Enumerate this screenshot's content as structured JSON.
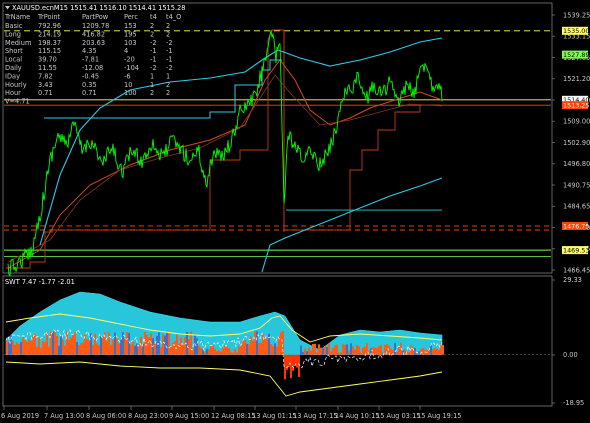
{
  "main_chart": {
    "header": "XAUUSD.ecnM15  1515.41  1516.10  1514.41  1515.28",
    "colors": {
      "background": "#000000",
      "price": "#00ff00",
      "upper_band": "#2fc9e6",
      "lower_band": "#2fc9e6",
      "ma_main": "#d04a1e",
      "ma_inner": "#8b3518",
      "frame": "#7f7f7f",
      "level_yellow": "#ffff66",
      "level_green": "#7cff4a",
      "level_orange": "#ff4500"
    },
    "price_axis": {
      "min": 1463.0,
      "max": 1543.0,
      "labels": [
        "1539.25",
        "1533.15",
        "1527.05",
        "1521.20",
        "1515.10",
        "1509.00",
        "1502.90",
        "1496.80",
        "1490.75",
        "1484.65",
        "1478.60",
        "1472.45",
        "1466.45"
      ]
    },
    "price_tags": [
      {
        "text": "1535.00",
        "value": 1535.0,
        "bg": "#ffff66",
        "fg": "#000000",
        "line": "dash"
      },
      {
        "text": "1527.89",
        "value": 1527.89,
        "bg": "#7cff4a",
        "fg": "#000000",
        "line": "none"
      },
      {
        "text": "1514.40",
        "value": 1514.4,
        "bg": "#ffffff",
        "fg": "#000000",
        "line": "solid-yellow"
      },
      {
        "text": "1513.25",
        "value": 1512.8,
        "bg": "#ff4500",
        "fg": "#ffffff",
        "line": "solid-orange"
      },
      {
        "text": "1476.75",
        "value": 1476.75,
        "bg": "#ff4500",
        "fg": "#ffffff",
        "line": "dash-orange"
      },
      {
        "text": "1469.53",
        "value": 1469.53,
        "bg": "#ffff66",
        "fg": "#000000",
        "line": "solid-green"
      }
    ],
    "stats_table": {
      "columns": [
        "TrName",
        "TrPoint",
        "PartPow",
        "Perc",
        "t4",
        "t4_O"
      ],
      "rows": [
        [
          "Basic",
          "792.96",
          "1209.78",
          "153",
          "2",
          "2"
        ],
        [
          "Long",
          "214.19",
          "416.82",
          "195",
          "2",
          "2"
        ],
        [
          "Medium",
          "198.37",
          "203.63",
          "103",
          "-2",
          "-2"
        ],
        [
          "Short",
          "115.15",
          "4.35",
          "4",
          "-1",
          "-1"
        ],
        [
          "Local",
          "39.70",
          "-7.81",
          "-20",
          "-1",
          "-1"
        ],
        [
          "Daily",
          "11.55",
          "-12.08",
          "-104",
          "-2",
          "-2"
        ],
        [
          "IDay",
          "7.82",
          "-0.45",
          "-6",
          "1",
          "1"
        ],
        [
          "Hourly",
          "3.43",
          "0.35",
          "10",
          "1",
          "2"
        ],
        [
          "Hour",
          "0.71",
          "0.71",
          "100",
          "2",
          "2"
        ]
      ],
      "footer": "V=4.71"
    }
  },
  "sub_chart": {
    "header": "SWT 7.47  -1.77  -2.01",
    "axis_labels": [
      "29.33",
      "0.00",
      "-18.95"
    ],
    "min": -18.95,
    "max": 29.33,
    "colors": {
      "cloud": "#28c6da",
      "cloud_edge": "#3fe0f0",
      "hist_pos": "#ff5a16",
      "hist_blue": "#3a70c8",
      "hist_neg": "#ff3300",
      "envelope": "#ffff66",
      "signal": "#ffffff"
    }
  },
  "time_axis": {
    "labels": [
      "6 Aug 2019",
      "7 Aug 13:00",
      "8 Aug 06:00",
      "8 Aug 23:00",
      "9 Aug 15:00",
      "12 Aug 08:15",
      "13 Aug 01:15",
      "13 Aug 17:15",
      "14 Aug 10:15",
      "15 Aug 03:15",
      "15 Aug 19:15"
    ]
  }
}
